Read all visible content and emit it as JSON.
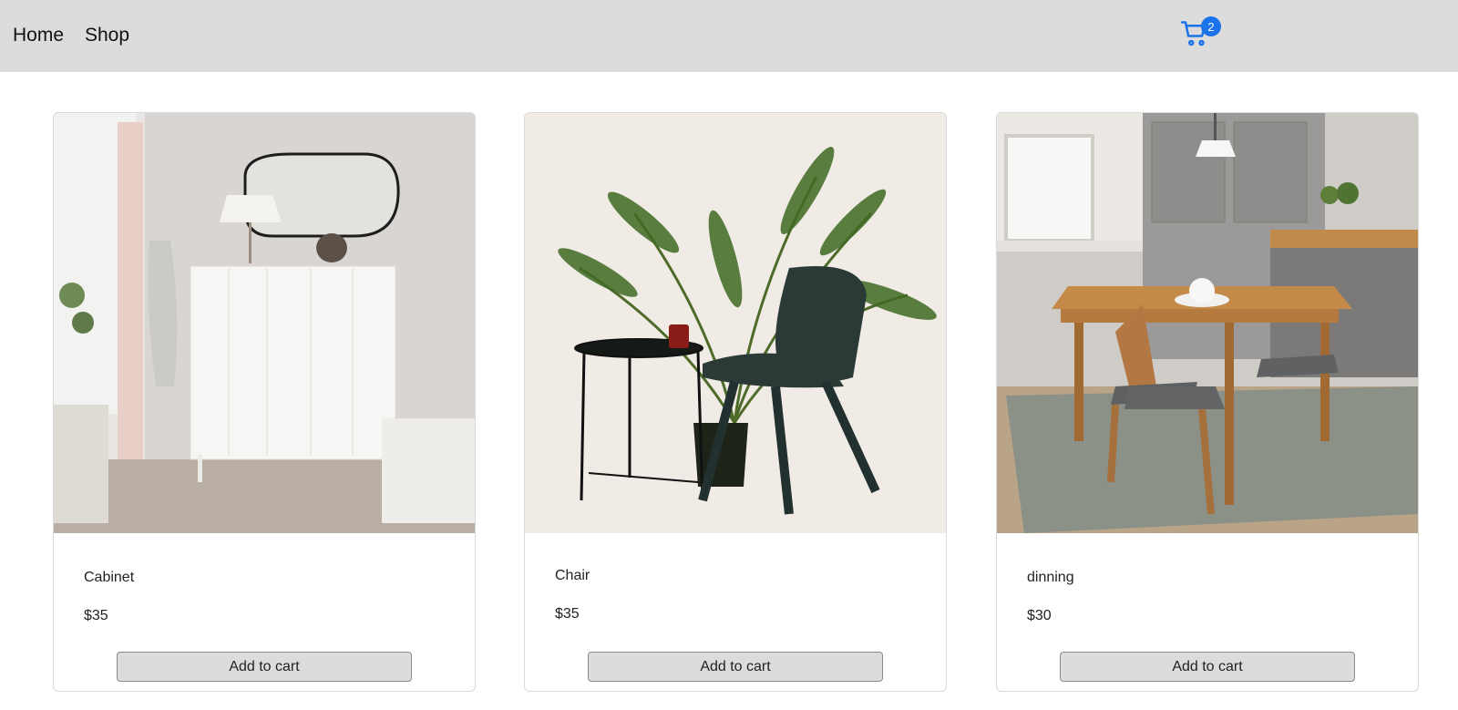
{
  "nav": {
    "home_label": "Home",
    "shop_label": "Shop"
  },
  "cart": {
    "icon": "cart-icon",
    "count": "2",
    "accent": "#1a73e8"
  },
  "products": [
    {
      "title": "Cabinet",
      "price": "$35",
      "button_label": "Add to cart",
      "image": "white-cabinet-room-photo"
    },
    {
      "title": "Chair",
      "price": "$35",
      "button_label": "Add to cart",
      "image": "green-chair-palm-plant-photo"
    },
    {
      "title": "dinning",
      "price": "$30",
      "button_label": "Add to cart",
      "image": "wooden-dining-set-kitchen-photo"
    }
  ]
}
